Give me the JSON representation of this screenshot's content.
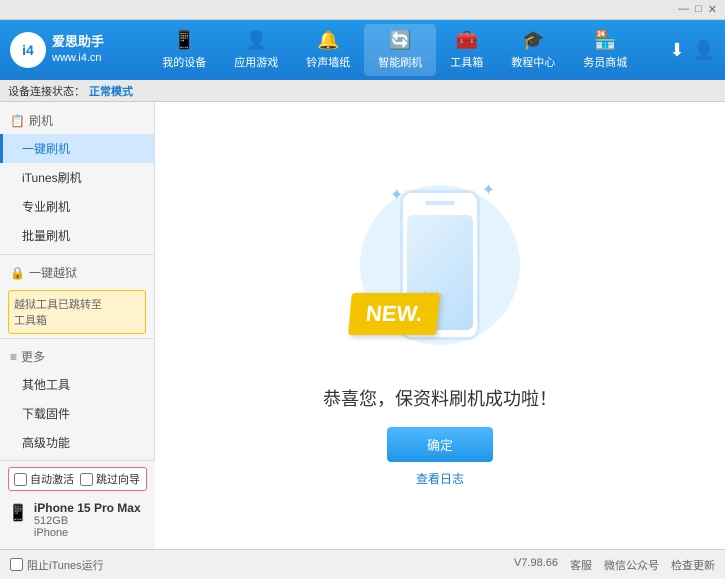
{
  "app": {
    "logo_text": "i4",
    "brand_name": "爱思助手",
    "website": "www.i4.cn"
  },
  "nav": {
    "items": [
      {
        "id": "my-device",
        "icon": "📱",
        "label": "我的设备"
      },
      {
        "id": "app-games",
        "icon": "👤",
        "label": "应用游戏"
      },
      {
        "id": "ringtone",
        "icon": "🔔",
        "label": "铃声墙纸"
      },
      {
        "id": "smart-flash",
        "icon": "🔄",
        "label": "智能刷机",
        "active": true
      },
      {
        "id": "toolbox",
        "icon": "🧰",
        "label": "工具箱"
      },
      {
        "id": "tutorial",
        "icon": "🎓",
        "label": "教程中心"
      },
      {
        "id": "merchant",
        "icon": "🏪",
        "label": "务员商城"
      }
    ]
  },
  "titlebar": {
    "btn_min": "—",
    "btn_max": "□",
    "btn_close": "✕"
  },
  "status": {
    "label": "设备连接状态：",
    "mode": "正常模式"
  },
  "sidebar": {
    "flash_section": "刷机",
    "items": [
      {
        "id": "one-key-flash",
        "label": "一键刷机",
        "active": true
      },
      {
        "id": "itunes-flash",
        "label": "iTunes刷机"
      },
      {
        "id": "pro-flash",
        "label": "专业刷机"
      },
      {
        "id": "batch-flash",
        "label": "批量刷机"
      }
    ],
    "disabled_item": "一键越狱",
    "warning_text": "越狱工具已跳转至\n工具箱",
    "more_section": "更多",
    "more_items": [
      {
        "id": "other-tools",
        "label": "其他工具"
      },
      {
        "id": "download-firmware",
        "label": "下载固件"
      },
      {
        "id": "advanced",
        "label": "高级功能"
      }
    ]
  },
  "main": {
    "success_title": "恭喜您，保资料刷机成功啦！",
    "confirm_btn": "确定",
    "log_link": "查看日志",
    "new_badge": "NEW.",
    "sparkle1": "✦",
    "sparkle2": "✦"
  },
  "device": {
    "auto_activate_label": "自动激活",
    "guide_label": "跳过向导",
    "name": "iPhone 15 Pro Max",
    "storage": "512GB",
    "type": "iPhone"
  },
  "footer": {
    "itunes_label": "阻止iTunes运行",
    "version": "V7.98.66",
    "links": [
      "客服",
      "微信公众号",
      "检查更新"
    ]
  }
}
